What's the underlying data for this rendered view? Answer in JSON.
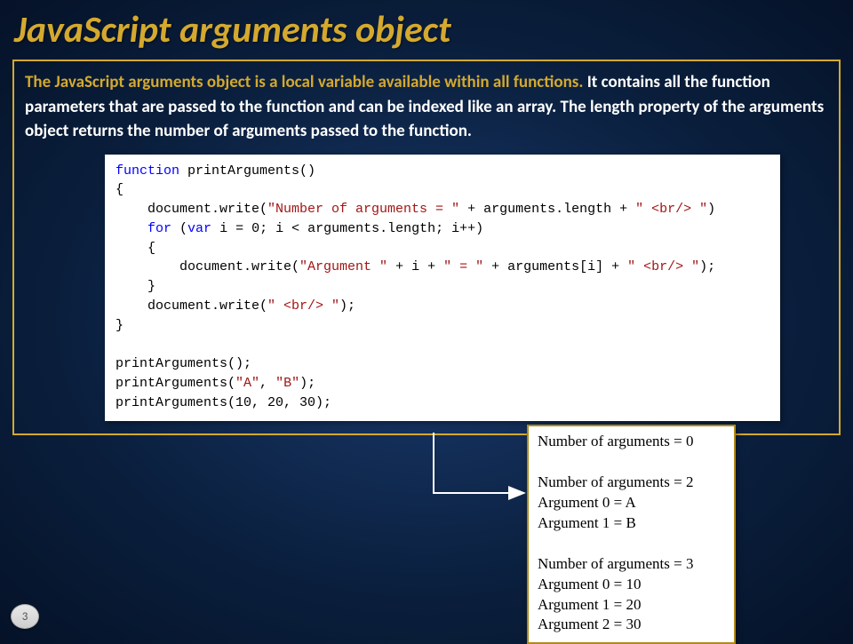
{
  "title": "JavaScript arguments object",
  "intro": {
    "lead": "The JavaScript arguments object is a local variable available within all functions.",
    "rest": " It contains all the function parameters that are passed to the function and can be indexed like an array. The length property of the arguments object returns the number of arguments passed to the function."
  },
  "code": {
    "l1a": "function",
    "l1b": " printArguments()",
    "l2": "{",
    "l3a": "    document.write(",
    "l3b": "\"Number of arguments = \"",
    "l3c": " + arguments.length + ",
    "l3d": "\" <br/> \"",
    "l3e": ")",
    "l4a": "    ",
    "l4b": "for",
    "l4c": " (",
    "l4d": "var",
    "l4e": " i = 0; i < arguments.length; i++)",
    "l5": "    {",
    "l6a": "        document.write(",
    "l6b": "\"Argument \"",
    "l6c": " + i + ",
    "l6d": "\" = \"",
    "l6e": " + arguments[i] + ",
    "l6f": "\" <br/> \"",
    "l6g": ");",
    "l7": "    }",
    "l8a": "    document.write(",
    "l8b": "\" <br/> \"",
    "l8c": ");",
    "l9": "}",
    "l10": "",
    "l11": "printArguments();",
    "l12a": "printArguments(",
    "l12b": "\"A\"",
    "l12c": ", ",
    "l12d": "\"B\"",
    "l12e": ");",
    "l13": "printArguments(10, 20, 30);"
  },
  "output": {
    "lines": [
      "Number of arguments = 0",
      "",
      "Number of arguments = 2",
      "Argument 0 = A",
      "Argument 1 = B",
      "",
      "Number of arguments = 3",
      "Argument 0 = 10",
      "Argument 1 = 20",
      "Argument 2 = 30"
    ]
  },
  "slideNumber": "3"
}
